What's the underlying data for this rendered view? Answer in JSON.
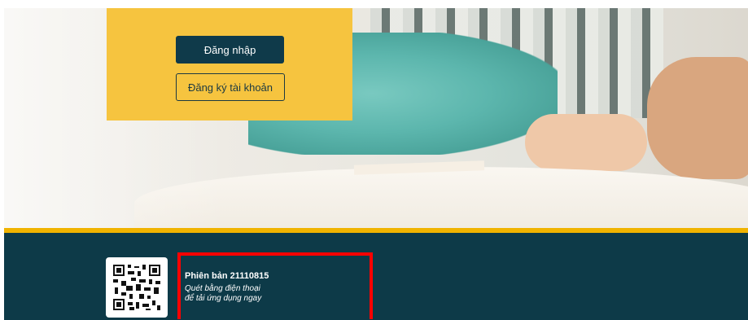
{
  "auth": {
    "login_label": "Đăng nhập",
    "register_label": "Đăng ký tài khoản"
  },
  "footer": {
    "version_label": "Phiên bản 21110815",
    "scan_line1": "Quét bằng điện thoại",
    "scan_line2": "để tải ứng dụng ngay",
    "qr_icon": "qr-code-icon"
  },
  "colors": {
    "panel_yellow": "#f6c43f",
    "primary_navy": "#0f3a4a",
    "footer_navy": "#0d3a48",
    "accent_gold": "#f0b300",
    "highlight_red": "#ff0000"
  }
}
